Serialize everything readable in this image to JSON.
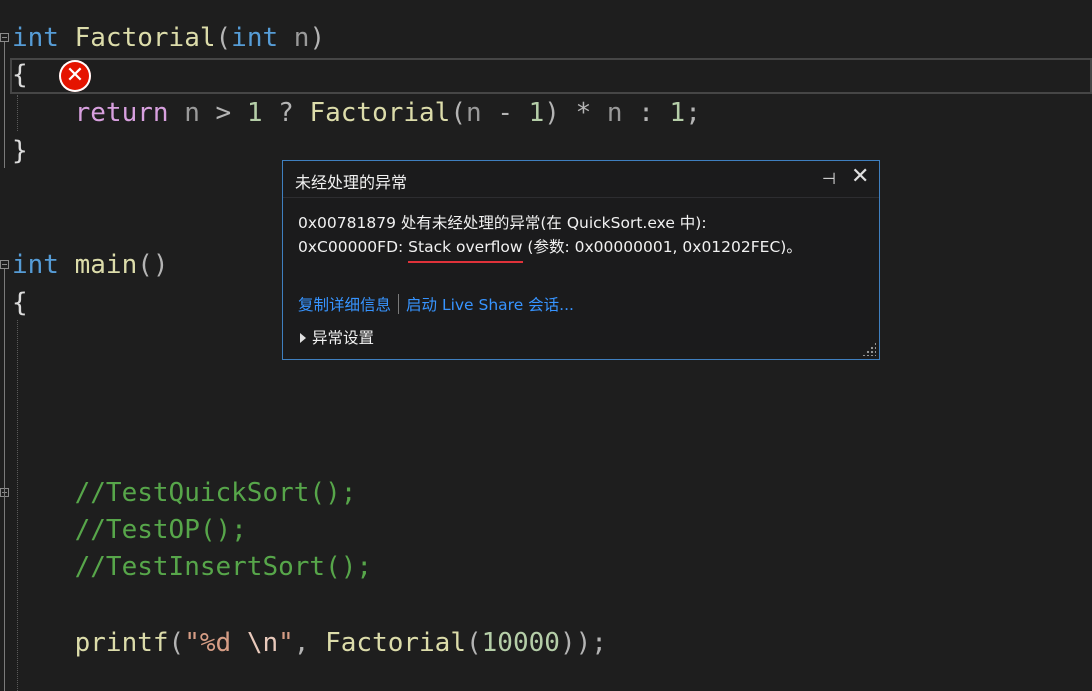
{
  "code": {
    "line1": {
      "kw": "int",
      "fn": "Factorial",
      "open": "(",
      "kw2": "int",
      "param": "n",
      "close": ")"
    },
    "line2": {
      "brace": "{"
    },
    "line3": {
      "ret": "return",
      "n1": "n",
      "gt": ">",
      "one": "1",
      "q": "?",
      "fn": "Factorial",
      "open": "(",
      "n2": "n",
      "minus": "-",
      "one2": "1",
      "close": ")",
      "mul": "*",
      "n3": "n",
      "colon": ":",
      "one3": "1",
      "semi": ";"
    },
    "line4": {
      "brace": "}"
    },
    "line5": {
      "kw": "int",
      "fn": "main",
      "parens": "()"
    },
    "line6": {
      "brace": "{"
    },
    "comment1": "//TestQuickSort();",
    "comment2": "//TestOP();",
    "comment3": "//TestInsertSort();",
    "printf": {
      "fn": "printf",
      "open": "(",
      "fmt1": "\"%d ",
      "esc": "\\n",
      "fmt2": "\"",
      "comma": ",",
      "fn2": "Factorial",
      "open2": "(",
      "num": "10000",
      "close": "));"
    }
  },
  "error_icon": {
    "icon": "error-x-icon",
    "glyph": "✕",
    "color": "#e51400"
  },
  "exception_popup": {
    "title": "未经处理的异常",
    "pin_glyph": "⊣",
    "close_glyph": "✕",
    "message_line1": "0x00781879 处有未经处理的异常(在 QuickSort.exe 中):",
    "message_line2_prefix": "0xC00000FD: ",
    "message_line2_highlight": "Stack overflow",
    "message_line2_suffix": " (参数: 0x00000001, 0x01202FEC)。",
    "link_copy": "复制详细信息",
    "link_liveshare": "启动 Live Share 会话...",
    "settings_label": "异常设置",
    "border_color": "#3f7fbf",
    "link_color": "#3794ff",
    "underline_color": "#e0323a"
  }
}
